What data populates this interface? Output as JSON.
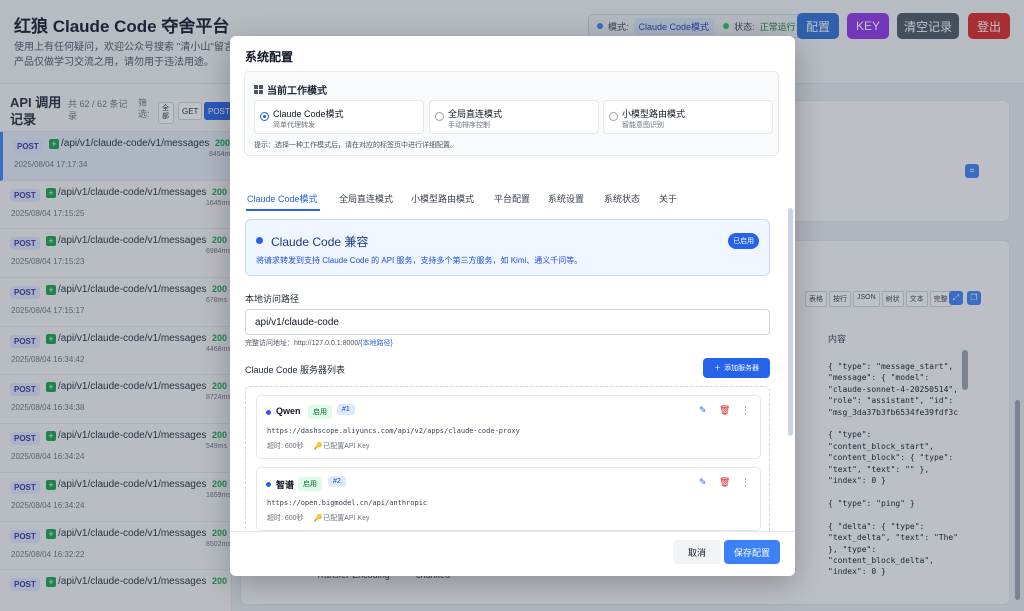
{
  "header": {
    "title": "红狼 Claude Code 夺舍平台",
    "subtitle": "使用上有任何疑问，欢迎公众号搜索 \"清小山\"留言。产品仅做学习交流之用，请勿用于违法用途。",
    "mode_label": "模式:",
    "mode_value": "Claude Code模式",
    "status_label": "状态:",
    "status_value": "正常运行",
    "btn_config": "配置",
    "btn_key": "KEY",
    "btn_clear": "清空记录",
    "btn_logout": "登出",
    "colors": {
      "config": "#2b6fd6",
      "key": "#9333ea",
      "clear": "#4b5563",
      "logout": "#dc2626"
    }
  },
  "log_panel": {
    "title": "API 调用记录",
    "count": "共 62 / 62 条记录",
    "filter_label": "筛选:",
    "filter_all": "全部",
    "filter_get": "GET",
    "filter_post": "POST",
    "items": [
      {
        "method": "POST",
        "path": "/api/v1/claude-code/v1/messages",
        "time": "2025/08/04 17:17:34",
        "code": "200",
        "ms": "8454ms"
      },
      {
        "method": "POST",
        "path": "/api/v1/claude-code/v1/messages",
        "time": "2025/08/04 17:15:25",
        "code": "200",
        "ms": "1645ms"
      },
      {
        "method": "POST",
        "path": "/api/v1/claude-code/v1/messages",
        "time": "2025/08/04 17:15:23",
        "code": "200",
        "ms": "6984ms"
      },
      {
        "method": "POST",
        "path": "/api/v1/claude-code/v1/messages",
        "time": "2025/08/04 17:15:17",
        "code": "200",
        "ms": "678ms"
      },
      {
        "method": "POST",
        "path": "/api/v1/claude-code/v1/messages",
        "time": "2025/08/04 16:34:42",
        "code": "200",
        "ms": "4468ms"
      },
      {
        "method": "POST",
        "path": "/api/v1/claude-code/v1/messages",
        "time": "2025/08/04 16:34:38",
        "code": "200",
        "ms": "8724ms"
      },
      {
        "method": "POST",
        "path": "/api/v1/claude-code/v1/messages",
        "time": "2025/08/04 16:34:24",
        "code": "200",
        "ms": "549ms"
      },
      {
        "method": "POST",
        "path": "/api/v1/claude-code/v1/messages",
        "time": "2025/08/04 16:34:24",
        "code": "200",
        "ms": "1859ms"
      },
      {
        "method": "POST",
        "path": "/api/v1/claude-code/v1/messages",
        "time": "2025/08/04 16:32:22",
        "code": "200",
        "ms": "8502ms"
      },
      {
        "method": "POST",
        "path": "/api/v1/claude-code/v1/messages",
        "time": "",
        "code": "200",
        "ms": ""
      }
    ]
  },
  "detail_bg": {
    "toolbar": [
      "表格",
      "按行",
      "JSON",
      "树状",
      "文本",
      "完整"
    ],
    "content_header": "内容",
    "json": "{ \"type\": \"message_start\",\n\"message\": { \"model\":\n\"claude-sonnet-4-20250514\",\n\"role\": \"assistant\", \"id\":\n\"msg_3da37b3fb6534fe39fdf3c\n\n{ \"type\":\n\"content_block_start\",\n\"content_block\": { \"type\":\n\"text\", \"text\": \"\" },\n\"index\": 0 }\n\n{ \"type\": \"ping\" }\n\n{ \"delta\": { \"type\":\n\"text_delta\", \"text\": \"The\"\n}, \"type\":\n\"content_block_delta\",\n\"index\": 0 }",
    "te_label": "Transfer-Encoding",
    "te_value": "chunked"
  },
  "modal": {
    "title": "系统配置",
    "mode_section_title": "当前工作模式",
    "modes": [
      {
        "title": "Claude Code模式",
        "sub": "简单代理转发",
        "selected": true
      },
      {
        "title": "全局直连模式",
        "sub": "手动排序控制",
        "selected": false
      },
      {
        "title": "小模型路由模式",
        "sub": "智能意图识别",
        "selected": false
      }
    ],
    "mode_hint": "提示：选择一种工作模式后，请在对应的标签页中进行详细配置。",
    "tabs": [
      "Claude Code模式",
      "全局直连模式",
      "小模型路由模式",
      "平台配置",
      "系统设置",
      "系统状态",
      "关于"
    ],
    "compat_title": "Claude Code 兼容",
    "compat_desc": "将请求转发到支持 Claude Code 的 API 服务，支持多个第三方服务，如 Kimi、通义千问等。",
    "compat_badge": "已启用",
    "path_label": "本地访问路径",
    "path_value": "api/v1/claude-code",
    "full_addr_prefix": "完整访问地址：http://127.0.0.1:8000/",
    "full_addr_link": "{本地路径}",
    "server_list_label": "Claude Code 服务器列表",
    "add_server": "添加服务器",
    "servers": [
      {
        "name": "Qwen",
        "status": "启用",
        "num": "#1",
        "url": "https://dashscope.aliyuncs.com/api/v2/apps/claude-code-proxy",
        "timeout": "超时: 600秒",
        "key": "已配置API Key"
      },
      {
        "name": "智谱",
        "status": "启用",
        "num": "#2",
        "url": "https://open.bigmodel.cn/api/anthropic",
        "timeout": "超时: 600秒",
        "key": "已配置API Key"
      }
    ],
    "cancel": "取消",
    "save": "保存配置"
  }
}
